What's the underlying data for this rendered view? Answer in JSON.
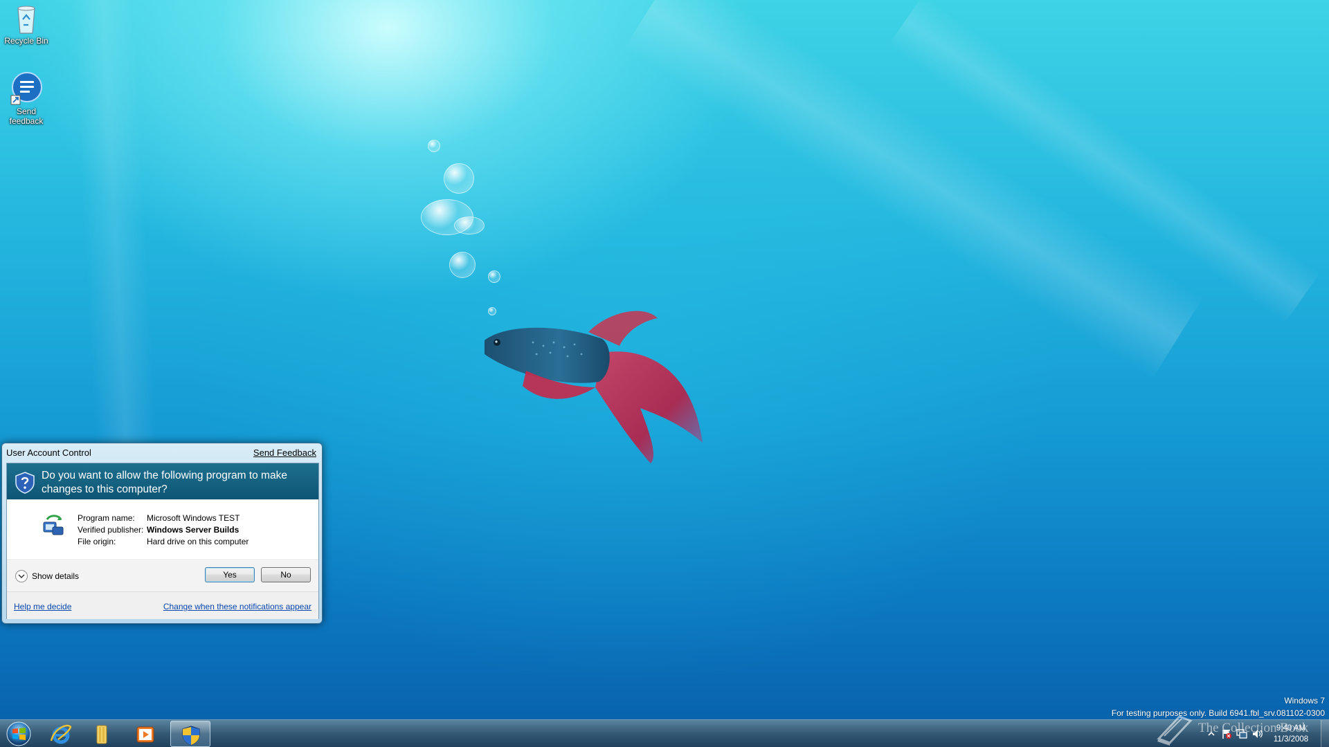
{
  "desktop": {
    "icons": [
      {
        "label": "Recycle Bin",
        "icon": "recycle-bin-icon"
      },
      {
        "label": "Send feedback",
        "icon": "send-feedback-icon"
      }
    ]
  },
  "uac": {
    "title": "User Account Control",
    "send_feedback": "Send Feedback",
    "question": "Do you want to allow the following program to make changes to this computer?",
    "fields": [
      {
        "label": "Program name:",
        "value": "Microsoft Windows TEST"
      },
      {
        "label": "Verified publisher:",
        "value": "Windows Server Builds"
      },
      {
        "label": "File origin:",
        "value": "Hard drive on this computer"
      }
    ],
    "show_details": "Show details",
    "yes": "Yes",
    "no": "No",
    "help_link": "Help me decide",
    "change_link": "Change when these notifications appear",
    "colors": {
      "banner": "#1e6f8f",
      "link": "#0645ad"
    }
  },
  "watermark": {
    "line1": "Windows 7",
    "line2": "For testing purposes only. Build 6941.fbl_srv.081102-0300",
    "collection_book": "The Collection Book"
  },
  "taskbar": {
    "pinned": [
      {
        "name": "internet-explorer",
        "icon": "ie-icon"
      },
      {
        "name": "windows-explorer",
        "icon": "folder-icon"
      },
      {
        "name": "media-player",
        "icon": "media-player-icon"
      },
      {
        "name": "user-account-control",
        "icon": "uac-shield-icon",
        "active": true
      }
    ],
    "clock": {
      "time": "9:40 AM",
      "date": "11/3/2008"
    }
  }
}
